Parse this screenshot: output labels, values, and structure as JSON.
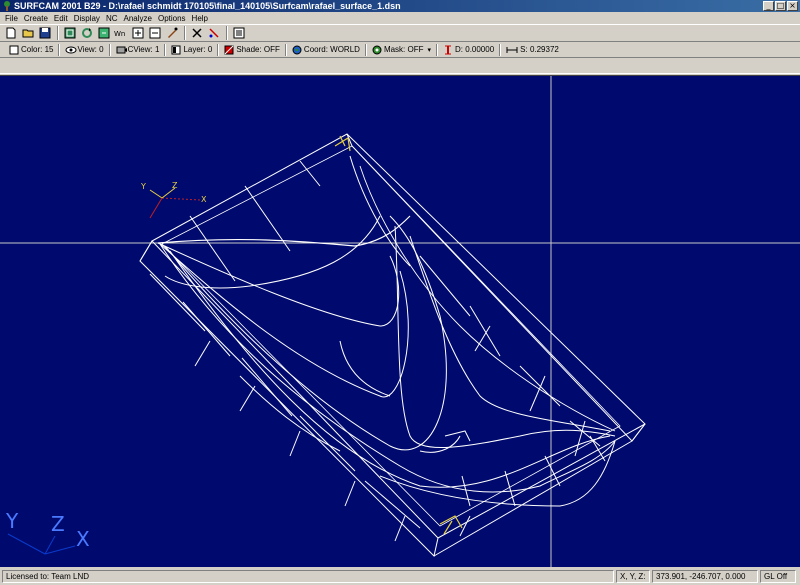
{
  "window": {
    "title": "SURFCAM 2001 B29 - D:\\rafael schmidt 170105\\final_140105\\Surfcam\\rafael_surface_1.dsn",
    "minimize": "_",
    "maximize": "□",
    "close": "×"
  },
  "menu": [
    "File",
    "Create",
    "Edit",
    "Display",
    "NC",
    "Analyze",
    "Options",
    "Help"
  ],
  "toolbar": {
    "icons": [
      "new-file-icon",
      "open-folder-icon",
      "save-icon",
      "zoom-all-icon",
      "rotate-icon",
      "refresh-icon",
      "zoom-window-icon",
      "zoom-in-icon",
      "zoom-out-icon",
      "pan-icon",
      "delete-icon",
      "trim-icon",
      "list-icon"
    ]
  },
  "status": {
    "color": "Color: 15",
    "view": "View: 0",
    "cview": "CView: 1",
    "layer": "Layer: 0",
    "shade": "Shade: OFF",
    "coord": "Coord: WORLD",
    "mask": "Mask: OFF",
    "depth": "D: 0.00000",
    "scale": "S: 0.29372"
  },
  "viewport": {
    "background": "#000a6e",
    "wire_color": "#ffffff",
    "axis_labels": {
      "x": "X",
      "y": "Y",
      "z": "Z"
    }
  },
  "bottom": {
    "license": "Licensed to: Team LND",
    "coord_label": "X, Y, Z:",
    "coord_value": "373.901, -246.707, 0.000",
    "gl": "GL Off"
  }
}
